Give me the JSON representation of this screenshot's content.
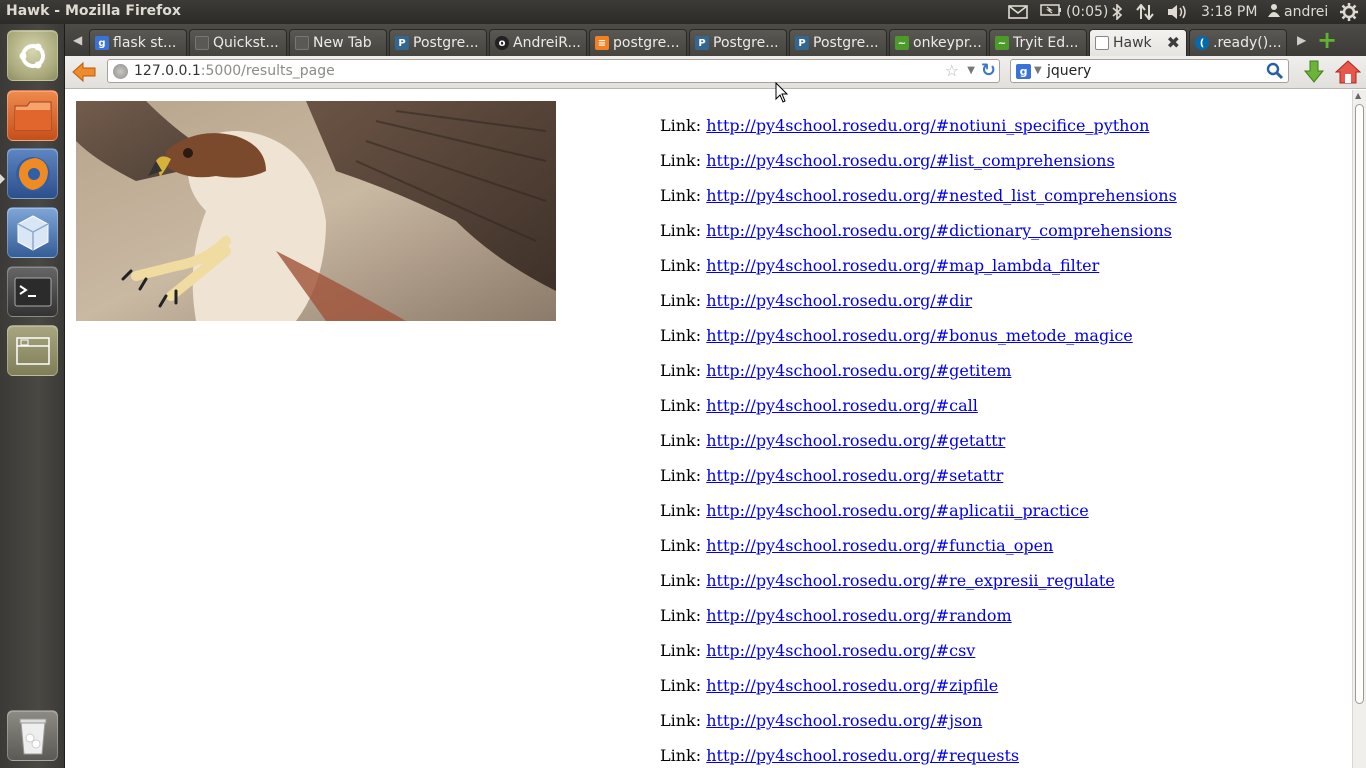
{
  "window": {
    "title": "Hawk - Mozilla Firefox"
  },
  "top_panel": {
    "battery": "(0:05)",
    "clock": "3:18 PM",
    "user": "andrei",
    "icons": [
      "mail-icon",
      "battery-icon",
      "bluetooth-icon",
      "network-icon",
      "volume-icon",
      "user-icon",
      "gear-icon"
    ]
  },
  "launcher": {
    "items": [
      "dash-home",
      "files",
      "firefox",
      "virtualbox",
      "terminal",
      "workspace-switcher",
      "trash"
    ]
  },
  "tabs": [
    {
      "label": "flask st...",
      "favicon": "google",
      "color": "#3a73d8",
      "active": false
    },
    {
      "label": "Quickst...",
      "favicon": "blank",
      "color": "#5b5955",
      "active": false
    },
    {
      "label": "New Tab",
      "favicon": "blank",
      "color": "#5b5955",
      "active": false
    },
    {
      "label": "Postgre...",
      "favicon": "postgresql",
      "color": "#336791",
      "active": false
    },
    {
      "label": "AndreiR...",
      "favicon": "github",
      "color": "#222222",
      "active": false
    },
    {
      "label": "postgre...",
      "favicon": "stackoverflow",
      "color": "#f48024",
      "active": false
    },
    {
      "label": "Postgre...",
      "favicon": "postgresql",
      "color": "#336791",
      "active": false
    },
    {
      "label": "Postgre...",
      "favicon": "postgresql",
      "color": "#336791",
      "active": false
    },
    {
      "label": "onkeypr...",
      "favicon": "chart",
      "color": "#4c9a2a",
      "active": false
    },
    {
      "label": "Tryit Ed...",
      "favicon": "chart",
      "color": "#4c9a2a",
      "active": false
    },
    {
      "label": "Hawk",
      "favicon": "blank",
      "color": "#ffffff",
      "active": true
    },
    {
      "label": ".ready()...",
      "favicon": "jquery",
      "color": "#0769ad",
      "active": false
    }
  ],
  "urlbar": {
    "host": "127.0.0.1",
    "rest": ":5000/results_page"
  },
  "searchbar": {
    "engine": "g",
    "query": "jquery"
  },
  "page": {
    "image_alt": "Red-tailed hawk",
    "link_prefix": "Link:",
    "links": [
      "http://py4school.rosedu.org/#notiuni_specifice_python",
      "http://py4school.rosedu.org/#list_comprehensions",
      "http://py4school.rosedu.org/#nested_list_comprehensions",
      "http://py4school.rosedu.org/#dictionary_comprehensions",
      "http://py4school.rosedu.org/#map_lambda_filter",
      "http://py4school.rosedu.org/#dir",
      "http://py4school.rosedu.org/#bonus_metode_magice",
      "http://py4school.rosedu.org/#getitem",
      "http://py4school.rosedu.org/#call",
      "http://py4school.rosedu.org/#getattr",
      "http://py4school.rosedu.org/#setattr",
      "http://py4school.rosedu.org/#aplicatii_practice",
      "http://py4school.rosedu.org/#functia_open",
      "http://py4school.rosedu.org/#re_expresii_regulate",
      "http://py4school.rosedu.org/#random",
      "http://py4school.rosedu.org/#csv",
      "http://py4school.rosedu.org/#zipfile",
      "http://py4school.rosedu.org/#json",
      "http://py4school.rosedu.org/#requests"
    ]
  }
}
